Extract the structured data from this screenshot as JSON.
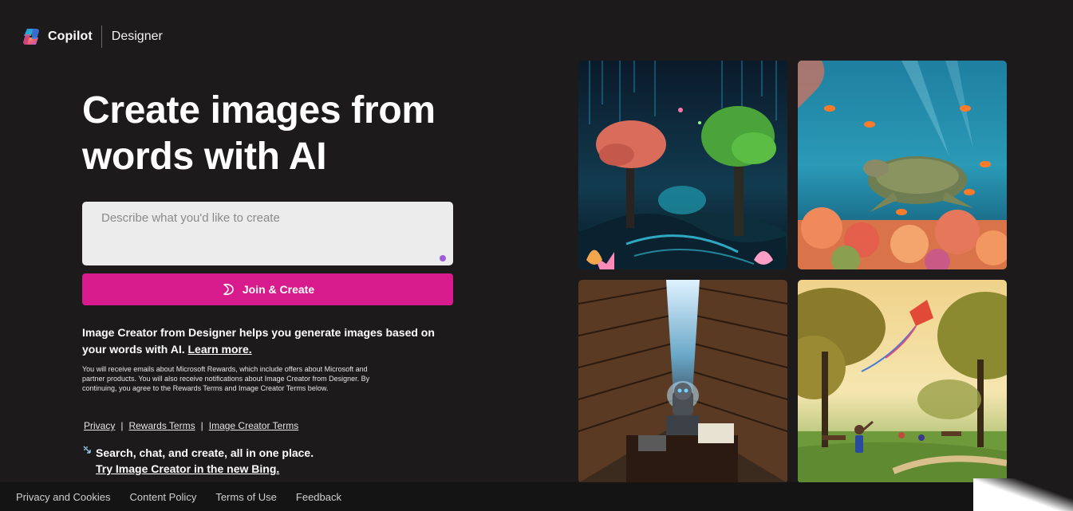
{
  "header": {
    "brand": "Copilot",
    "product": "Designer"
  },
  "hero": {
    "title": "Create images from words with AI"
  },
  "prompt": {
    "placeholder": "Describe what you'd like to create",
    "value": ""
  },
  "create_button": {
    "label": "Join & Create"
  },
  "description": {
    "text": "Image Creator from Designer helps you generate images based on your words with AI.",
    "link": "Learn more."
  },
  "fine_print": "You will receive emails about Microsoft Rewards, which include offers about Microsoft and partner products. You will also receive notifications about Image Creator from Designer. By continuing, you agree to the Rewards Terms and Image Creator Terms below.",
  "legal_links": [
    {
      "label": "Privacy"
    },
    {
      "label": "Rewards Terms"
    },
    {
      "label": "Image Creator Terms"
    }
  ],
  "legal_separator": "|",
  "promo": {
    "text": "Search, chat, and create, all in one place.",
    "link": "Try Image Creator in the new Bing."
  },
  "footer": {
    "links": [
      {
        "label": "Privacy and Cookies"
      },
      {
        "label": "Content Policy"
      },
      {
        "label": "Terms of Use"
      },
      {
        "label": "Feedback"
      }
    ]
  },
  "gallery": [
    {
      "subject": "glowing-fantasy-forest"
    },
    {
      "subject": "sea-turtle-coral-reef"
    },
    {
      "subject": "robot-in-library"
    },
    {
      "subject": "child-flying-kite-in-park"
    }
  ],
  "colors": {
    "background": "#1c1a1a",
    "accent_button": "#d81b8c",
    "prompt_background": "#ececec",
    "footer_background": "#141414"
  }
}
